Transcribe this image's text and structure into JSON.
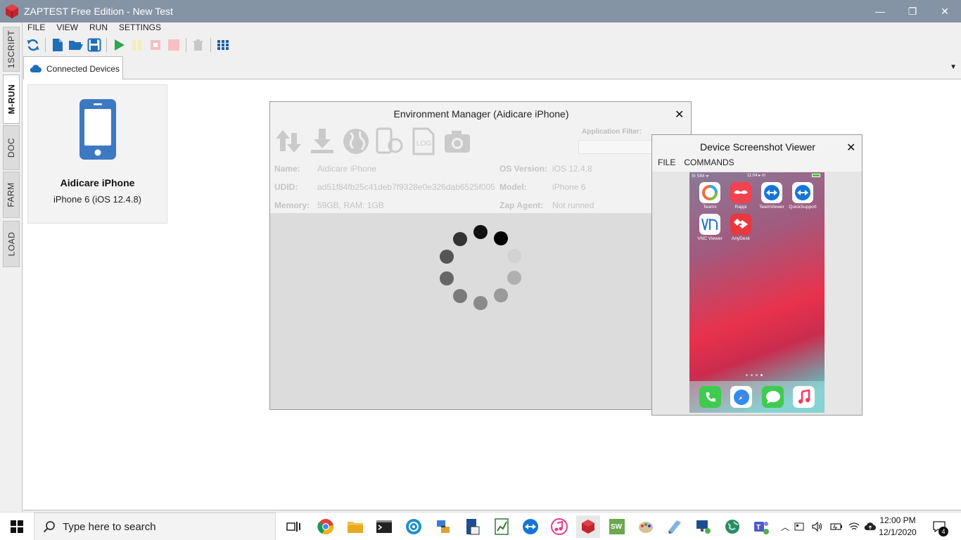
{
  "window": {
    "title": "ZAPTEST Free Edition - New Test",
    "controls": {
      "minimize": "—",
      "restore": "❐",
      "close": "✕"
    }
  },
  "side_tabs": [
    {
      "label": "1SCRIPT",
      "active": false
    },
    {
      "label": "M-RUN",
      "active": true
    },
    {
      "label": "DOC",
      "active": false
    },
    {
      "label": "FARM",
      "active": false
    },
    {
      "label": "LOAD",
      "active": false
    }
  ],
  "menu": [
    "FILE",
    "VIEW",
    "RUN",
    "SETTINGS"
  ],
  "toolbar": {
    "icons": [
      "refresh-icon",
      "new-file-icon",
      "open-folder-icon",
      "save-icon",
      "play-icon",
      "pause-icon",
      "stop-icon",
      "record-icon",
      "delete-icon",
      "grid-icon"
    ]
  },
  "doc_tab": {
    "label": "Connected Devices",
    "icon": "cloud-icon"
  },
  "device_card": {
    "name": "Aidicare iPhone",
    "subtitle": "iPhone 6 (iOS 12.4.8)"
  },
  "env_manager": {
    "title": "Environment Manager (Aidicare iPhone)",
    "filter_label": "Application Filter:",
    "filter_value": "",
    "fields": {
      "name_label": "Name:",
      "name_value": "Aidicare iPhone",
      "udid_label": "UDID:",
      "udid_value": "ad51f84fb25c41deb7f9328e0e326dab6525f005",
      "memory_label": "Memory:",
      "memory_value": "59GB, RAM: 1GB",
      "os_label": "OS Version:",
      "os_value": "iOS 12.4.8",
      "model_label": "Model:",
      "model_value": "iPhone 6",
      "agent_label": "Zap Agent:",
      "agent_value": "Not runned"
    }
  },
  "screenshot_viewer": {
    "title": "Device Screenshot Viewer",
    "menu": [
      "FILE",
      "COMMANDS"
    ],
    "status": {
      "carrier": "SI SIM ᯤ",
      "time": "11:04 ▸ m"
    },
    "apps": [
      {
        "label": "Teams",
        "color": "#ffffff"
      },
      {
        "label": "Rappi",
        "color": "#f2424e"
      },
      {
        "label": "TeamViewer",
        "color": "#1476d6"
      },
      {
        "label": "QuickSupport",
        "color": "#1476d6"
      },
      {
        "label": "VNC Viewer",
        "color": "#1f6fd1"
      },
      {
        "label": "AnyDesk",
        "color": "#e8373e"
      }
    ],
    "dock": [
      "phone-icon",
      "safari-icon",
      "messages-icon",
      "music-icon"
    ]
  },
  "taskbar": {
    "search_placeholder": "Type here to search",
    "time": "12:00 PM",
    "date": "12/1/2020",
    "notification_count": "4"
  }
}
